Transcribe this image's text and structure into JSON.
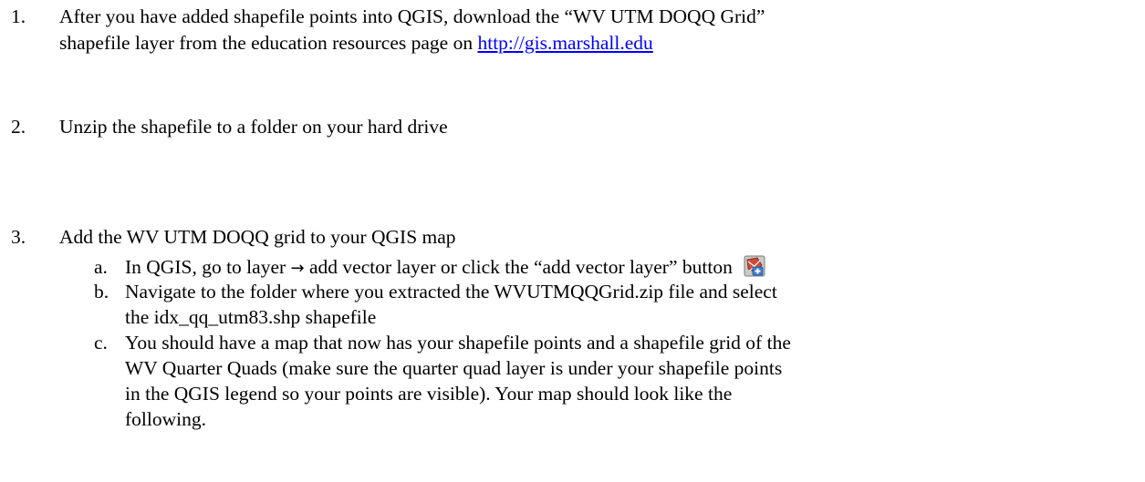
{
  "items": [
    {
      "number": "1.",
      "lines": [
        "After you have added shapefile points into QGIS, download the “WV UTM DOQQ Grid”",
        "shapefile layer from the education resources page on "
      ],
      "link_text": "http://gis.marshall.edu"
    },
    {
      "number": "2.",
      "lines": [
        "Unzip the shapefile to a folder on your hard drive"
      ]
    },
    {
      "number": "3.",
      "lines": [
        "Add the WV UTM DOQQ grid to your QGIS map"
      ],
      "subitems": [
        {
          "letter": "a.",
          "before_arrow": "In QGIS, go to layer",
          "arrow": "→",
          "after_arrow": "add vector layer or click the “add vector layer” button",
          "icon": "add-vector-layer-icon"
        },
        {
          "letter": "b.",
          "lines": [
            "Navigate to the folder where you extracted the WVUTMQQGrid.zip file and select",
            "the idx_qq_utm83.shp shapefile"
          ]
        },
        {
          "letter": "c.",
          "lines": [
            "You should have a map that now has your shapefile points and a shapefile grid of the",
            "WV Quarter Quads (make sure the quarter quad layer is under your shapefile points",
            "in the QGIS legend so your points are visible).  Your map should look like the",
            "following."
          ]
        }
      ]
    }
  ],
  "colors": {
    "text": "#000000",
    "link": "#0000ff",
    "background": "#ffffff"
  }
}
